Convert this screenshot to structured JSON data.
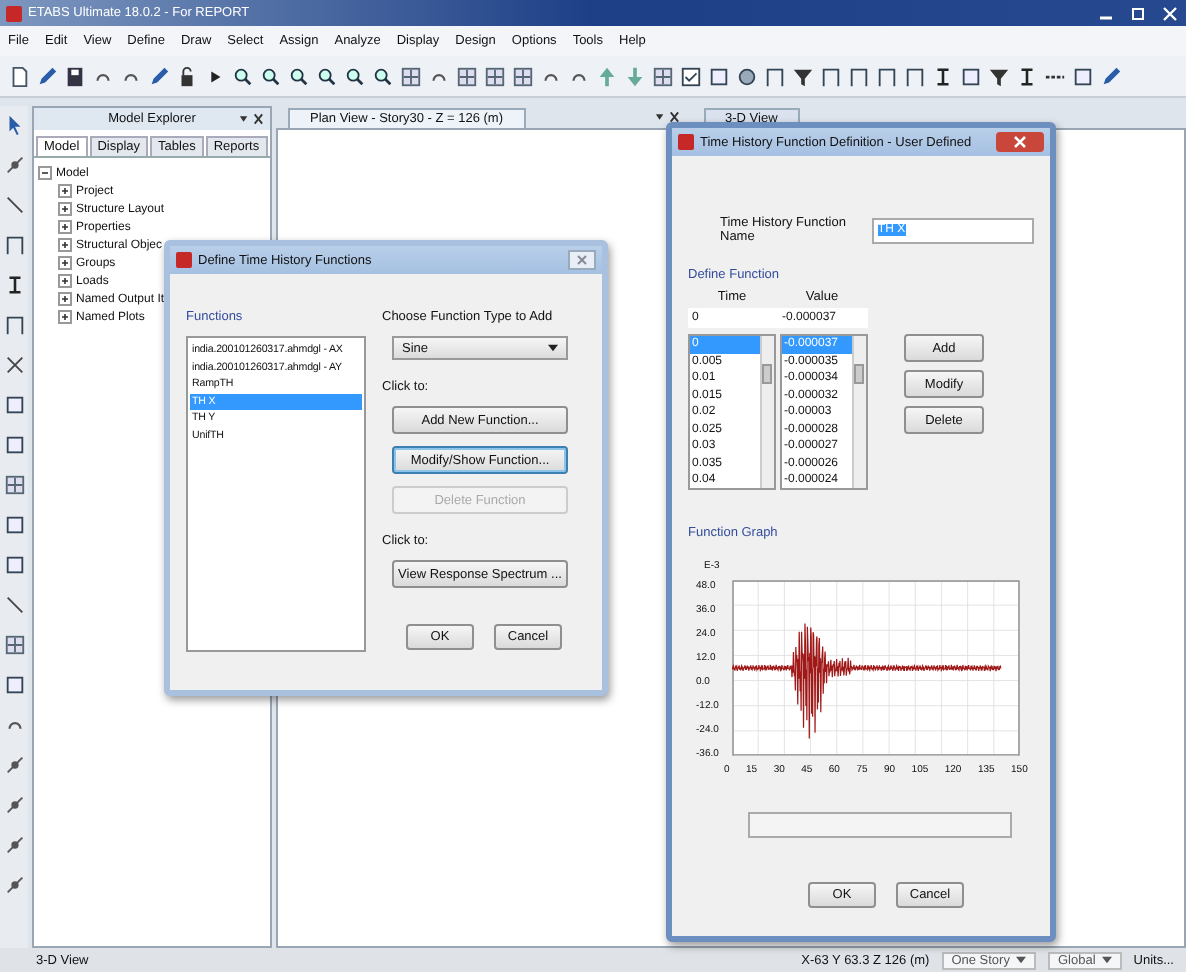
{
  "window": {
    "title": "ETABS Ultimate 18.0.2 - For REPORT"
  },
  "menu": [
    "File",
    "Edit",
    "View",
    "Define",
    "Draw",
    "Select",
    "Assign",
    "Analyze",
    "Display",
    "Design",
    "Options",
    "Tools",
    "Help"
  ],
  "model_explorer": {
    "title": "Model Explorer",
    "tabs": [
      {
        "label": "Model",
        "selected": true
      },
      {
        "label": "Display",
        "selected": false
      },
      {
        "label": "Tables",
        "selected": false
      },
      {
        "label": "Reports",
        "selected": false
      }
    ],
    "tree": [
      {
        "label": "Model",
        "expanded": true,
        "children": [
          {
            "label": "Project",
            "expanded": false
          },
          {
            "label": "Structure Layout",
            "expanded": false
          },
          {
            "label": "Properties",
            "expanded": false
          },
          {
            "label": "Structural Objec",
            "expanded": false
          },
          {
            "label": "Groups",
            "expanded": false
          },
          {
            "label": "Loads",
            "expanded": false
          },
          {
            "label": "Named Output It",
            "expanded": false
          },
          {
            "label": "Named Plots",
            "expanded": false
          }
        ]
      }
    ]
  },
  "document_tabs": [
    {
      "label": "Plan View - Story30 - Z = 126 (m)",
      "selected": true
    },
    {
      "label": "3-D View",
      "selected": false
    }
  ],
  "define_dialog": {
    "title": "Define Time History Functions",
    "functions_label": "Functions",
    "functions": [
      {
        "label": "india.200101260317.ahmdgl - AX",
        "selected": false
      },
      {
        "label": "india.200101260317.ahmdgl - AY",
        "selected": false
      },
      {
        "label": "RampTH",
        "selected": false
      },
      {
        "label": "TH X",
        "selected": true
      },
      {
        "label": "TH Y",
        "selected": false
      },
      {
        "label": "UnifTH",
        "selected": false
      }
    ],
    "type_label": "Choose Function Type to Add",
    "type_value": "Sine",
    "click_label_1": "Click to:",
    "buttons": [
      {
        "label": "Add New Function...",
        "disabled": false,
        "focused": false
      },
      {
        "label": "Modify/Show Function...",
        "disabled": false,
        "focused": true
      },
      {
        "label": "Delete Function",
        "disabled": true,
        "focused": false
      }
    ],
    "click_label_2": "Click to:",
    "spectrum_button": "View Response Spectrum ...",
    "ok": "OK",
    "cancel": "Cancel"
  },
  "definition_dialog": {
    "title": "Time History Function Definition - User Defined",
    "name_label": "Time History Function Name",
    "name_value": "TH X",
    "define_label": "Define Function",
    "time_header": "Time",
    "value_header": "Value",
    "time_input": "0",
    "value_input": "-0.000037",
    "times": [
      {
        "label": "0",
        "selected": true
      },
      {
        "label": "0.005",
        "selected": false
      },
      {
        "label": "0.01",
        "selected": false
      },
      {
        "label": "0.015",
        "selected": false
      },
      {
        "label": "0.02",
        "selected": false
      },
      {
        "label": "0.025",
        "selected": false
      },
      {
        "label": "0.03",
        "selected": false
      },
      {
        "label": "0.035",
        "selected": false
      },
      {
        "label": "0.04",
        "selected": false
      }
    ],
    "values": [
      {
        "label": "-0.000037",
        "selected": true
      },
      {
        "label": "-0.000035",
        "selected": false
      },
      {
        "label": "-0.000034",
        "selected": false
      },
      {
        "label": "-0.000032",
        "selected": false
      },
      {
        "label": "-0.00003",
        "selected": false
      },
      {
        "label": "-0.000028",
        "selected": false
      },
      {
        "label": "-0.000027",
        "selected": false
      },
      {
        "label": "-0.000026",
        "selected": false
      },
      {
        "label": "-0.000024",
        "selected": false
      }
    ],
    "buttons": [
      "Add",
      "Modify",
      "Delete"
    ],
    "graph_label": "Function Graph",
    "graph_scale": "E-3",
    "y_ticks": [
      "48.0",
      "36.0",
      "24.0",
      "12.0",
      "0.0",
      "-12.0",
      "-24.0",
      "-36.0"
    ],
    "x_ticks": [
      "0",
      "15",
      "30",
      "45",
      "60",
      "75",
      "90",
      "105",
      "120",
      "135",
      "150"
    ],
    "ok": "OK",
    "cancel": "Cancel"
  },
  "status_bar": {
    "view": "3-D View",
    "coordinates": "X-63 Y 63.3 Z 126 (m)",
    "story": "One Story",
    "system": "Global",
    "units": "Units..."
  }
}
